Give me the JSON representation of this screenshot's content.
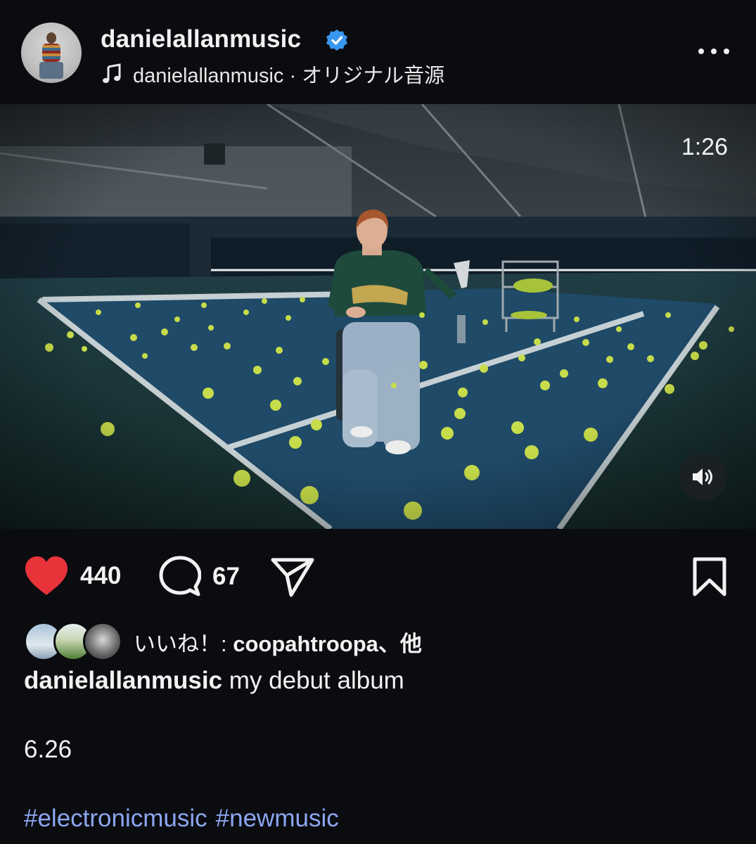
{
  "post": {
    "username": "danielallanmusic",
    "audio_label": "danielallanmusic · オリジナル音源",
    "video": {
      "duration": "1:26"
    },
    "likes": {
      "count": "440",
      "liked_by_text": "いいね！: ",
      "liked_by_user": "coopahtroopa",
      "suffix": "、他"
    },
    "comments": {
      "count": "67"
    },
    "caption": {
      "author": "danielallanmusic",
      "text": "my debut album",
      "date_line": "6.26"
    },
    "hashtags": [
      "#electronicmusic",
      "#newmusic"
    ]
  },
  "colors": {
    "background": "#0b0c10",
    "heart": "#e8333b",
    "verified": "#3897f0",
    "hashtag": "#8ca6f0"
  },
  "icons": [
    "verified-badge-icon",
    "music-note-icon",
    "more-options-icon",
    "speaker-icon",
    "heart-icon",
    "comment-icon",
    "share-icon",
    "bookmark-icon"
  ]
}
